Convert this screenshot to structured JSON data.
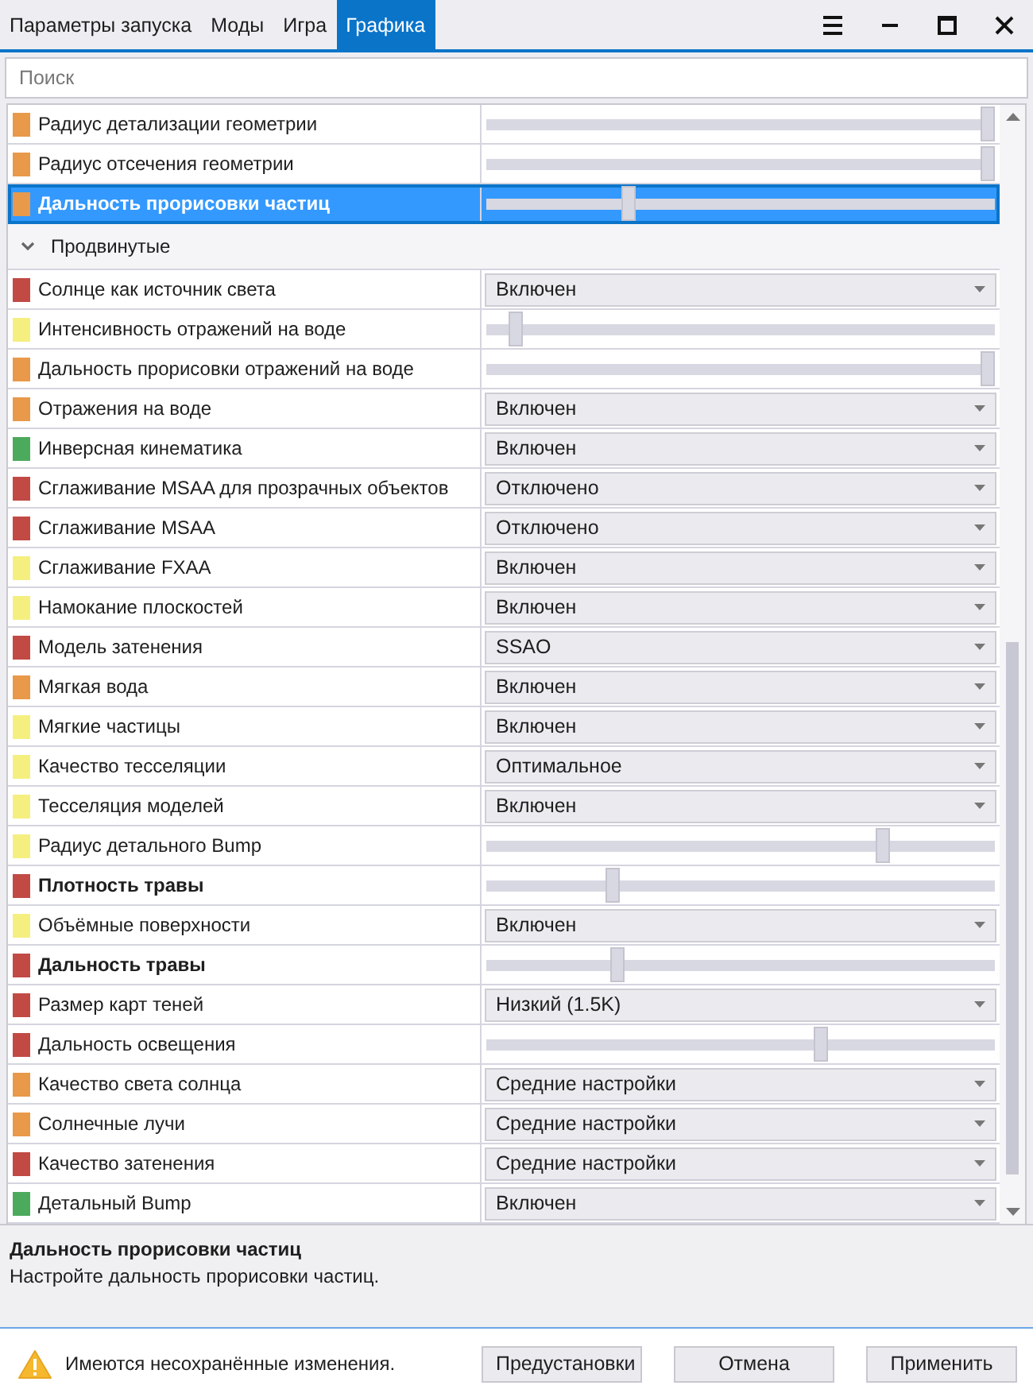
{
  "tabs": [
    {
      "label": "Параметры запуска",
      "selected": false
    },
    {
      "label": "Моды",
      "selected": false
    },
    {
      "label": "Игра",
      "selected": false
    },
    {
      "label": "Графика",
      "selected": true
    }
  ],
  "search": {
    "placeholder": "Поиск"
  },
  "top_rows": [
    {
      "name": "Радиус детализации геометрии",
      "color": "#e8994a",
      "kind": "slider",
      "level": 1.0,
      "selected": false,
      "bold": false
    },
    {
      "name": "Радиус отсечения геометрии",
      "color": "#e8994a",
      "kind": "slider",
      "level": 1.0,
      "selected": false,
      "bold": false
    },
    {
      "name": "Дальность прорисовки частиц",
      "color": "#e8994a",
      "kind": "slider",
      "level": 0.28,
      "selected": true,
      "bold": true
    }
  ],
  "group": {
    "title": "Продвинутые",
    "expanded": true,
    "rows": [
      {
        "name": "Солнце как источник света",
        "color": "#c24a44",
        "kind": "dropdown",
        "value": "Включен",
        "bold": false
      },
      {
        "name": "Интенсивность отражений на воде",
        "color": "#f5ef80",
        "kind": "slider",
        "level": 0.06,
        "bold": false
      },
      {
        "name": "Дальность прорисовки отражений на воде",
        "color": "#e8994a",
        "kind": "slider",
        "level": 1.0,
        "bold": false
      },
      {
        "name": "Отражения на воде",
        "color": "#e8994a",
        "kind": "dropdown",
        "value": "Включен",
        "bold": false
      },
      {
        "name": "Инверсная кинематика",
        "color": "#4caa5c",
        "kind": "dropdown",
        "value": "Включен",
        "bold": false
      },
      {
        "name": "Сглаживание MSAA для прозрачных объектов",
        "color": "#c24a44",
        "kind": "dropdown",
        "value": "Отключено",
        "bold": false
      },
      {
        "name": "Сглаживание MSAA",
        "color": "#c24a44",
        "kind": "dropdown",
        "value": "Отключено",
        "bold": false
      },
      {
        "name": "Сглаживание FXAA",
        "color": "#f5ef80",
        "kind": "dropdown",
        "value": "Включен",
        "bold": false
      },
      {
        "name": "Намокание плоскостей",
        "color": "#f5ef80",
        "kind": "dropdown",
        "value": "Включен",
        "bold": false
      },
      {
        "name": "Модель затенения",
        "color": "#c24a44",
        "kind": "dropdown",
        "value": "SSAO",
        "bold": false
      },
      {
        "name": "Мягкая вода",
        "color": "#e8994a",
        "kind": "dropdown",
        "value": "Включен",
        "bold": false
      },
      {
        "name": "Мягкие частицы",
        "color": "#f5ef80",
        "kind": "dropdown",
        "value": "Включен",
        "bold": false
      },
      {
        "name": "Качество тесселяции",
        "color": "#f5ef80",
        "kind": "dropdown",
        "value": "Оптимальное",
        "bold": false
      },
      {
        "name": "Тесселяция моделей",
        "color": "#f5ef80",
        "kind": "dropdown",
        "value": "Включен",
        "bold": false
      },
      {
        "name": "Радиус детального Bump",
        "color": "#f5ef80",
        "kind": "slider",
        "level": 0.78,
        "bold": false
      },
      {
        "name": "Плотность травы",
        "color": "#c24a44",
        "kind": "slider",
        "level": 0.25,
        "bold": true
      },
      {
        "name": "Объёмные поверхности",
        "color": "#f5ef80",
        "kind": "dropdown",
        "value": "Включен",
        "bold": false
      },
      {
        "name": "Дальность травы",
        "color": "#c24a44",
        "kind": "slider",
        "level": 0.26,
        "bold": true
      },
      {
        "name": "Размер карт теней",
        "color": "#c24a44",
        "kind": "dropdown",
        "value": "Низкий (1.5K)",
        "bold": false
      },
      {
        "name": "Дальность освещения",
        "color": "#c24a44",
        "kind": "slider",
        "level": 0.66,
        "bold": false
      },
      {
        "name": "Качество света солнца",
        "color": "#e8994a",
        "kind": "dropdown",
        "value": "Средние настройки",
        "bold": false
      },
      {
        "name": "Солнечные лучи",
        "color": "#e8994a",
        "kind": "dropdown",
        "value": "Средние настройки",
        "bold": false
      },
      {
        "name": "Качество затенения",
        "color": "#c24a44",
        "kind": "dropdown",
        "value": "Средние настройки",
        "bold": false
      },
      {
        "name": "Детальный Bump",
        "color": "#4caa5c",
        "kind": "dropdown",
        "value": "Включен",
        "bold": false
      }
    ]
  },
  "description": {
    "title": "Дальность прорисовки частиц",
    "text": "Настройте дальность прорисовки частиц."
  },
  "footer": {
    "warning": "Имеются несохранённые изменения.",
    "buttons": [
      "Предустановки",
      "Отмена",
      "Применить"
    ]
  }
}
